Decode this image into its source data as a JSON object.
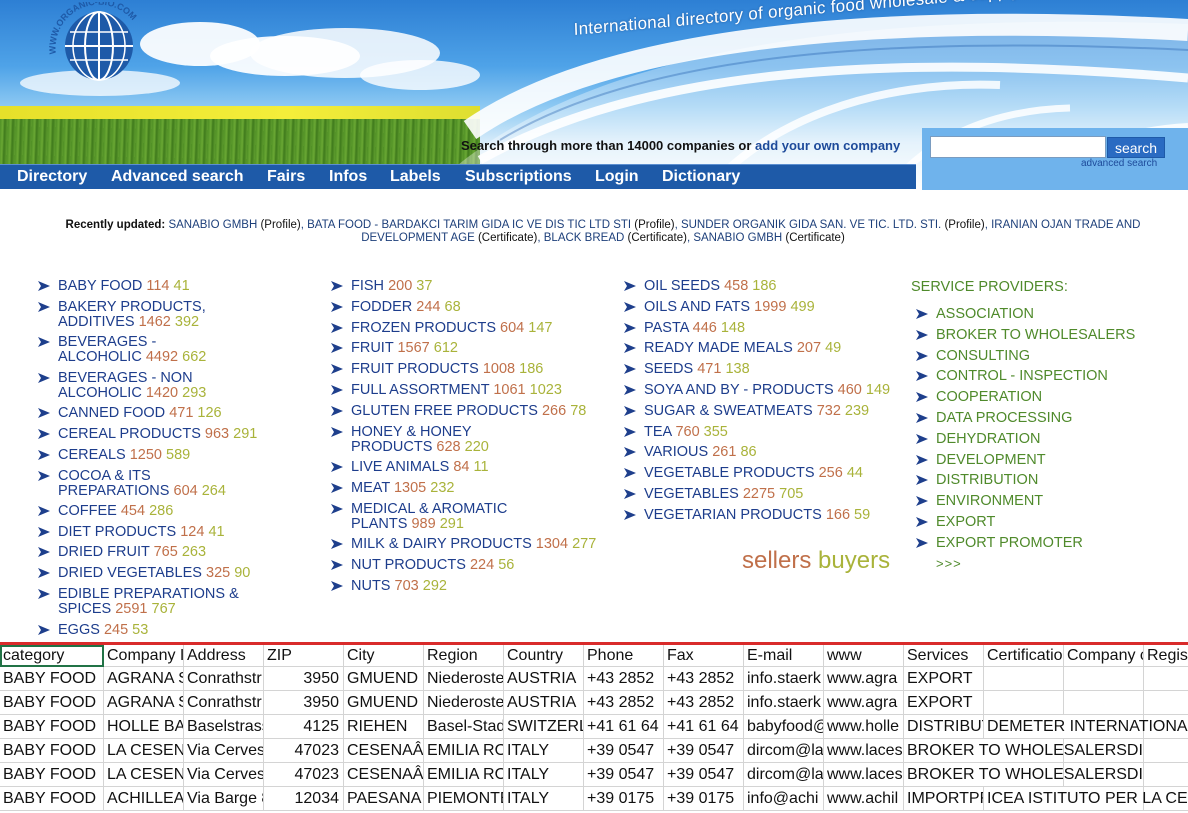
{
  "site": {
    "logo_text": "WWW.ORGANIC-BIO.COM",
    "tagline": "International directory of organic food wholesale & supply companies",
    "colors": {
      "nav_bg": "#1e5aa8",
      "link": "#1d3d8c",
      "count_sellers": "#c0704a",
      "count_buyers": "#a9b33a",
      "services": "#4f8a2b",
      "sheet_divider": "#d92b2b"
    }
  },
  "search": {
    "prompt": "Search through more than 14000 companies or ",
    "add_link": "add your own company",
    "input_value": "",
    "button_label": "search",
    "advanced_link": "advanced search"
  },
  "nav": [
    "Directory",
    "Advanced search",
    "Fairs",
    "Infos",
    "Labels",
    "Subscriptions",
    "Login",
    "Dictionary"
  ],
  "recent": {
    "label": "Recently updated:",
    "items": [
      {
        "name": "SANABIO GMBH",
        "type": "(Profile)"
      },
      {
        "name": "BATA FOOD - BARDAKCI TARIM GIDA IC VE DIS TIC LTD STI",
        "type": "(Profile)"
      },
      {
        "name": "SUNDER ORGANIK GIDA SAN. VE TIC. LTD. STI.",
        "type": "(Profile)"
      },
      {
        "name": "IRANIAN OJAN TRADE AND DEVELOPMENT AGE",
        "type": "(Certificate)"
      },
      {
        "name": "BLACK BREAD",
        "type": "(Certificate)"
      },
      {
        "name": "SANABIO GMBH",
        "type": "(Certificate)"
      }
    ]
  },
  "categories": {
    "col1": [
      {
        "l1": "BABY FOOD",
        "l2": "",
        "sellers": "114",
        "buyers": "41"
      },
      {
        "l1": "BAKERY PRODUCTS,",
        "l2": "ADDITIVES",
        "sellers": "1462",
        "buyers": "392"
      },
      {
        "l1": "BEVERAGES -",
        "l2": "ALCOHOLIC",
        "sellers": "4492",
        "buyers": "662"
      },
      {
        "l1": "BEVERAGES - NON",
        "l2": "ALCOHOLIC",
        "sellers": "1420",
        "buyers": "293"
      },
      {
        "l1": "CANNED FOOD",
        "l2": "",
        "sellers": "471",
        "buyers": "126"
      },
      {
        "l1": "CEREAL PRODUCTS",
        "l2": "",
        "sellers": "963",
        "buyers": "291"
      },
      {
        "l1": "CEREALS",
        "l2": "",
        "sellers": "1250",
        "buyers": "589"
      },
      {
        "l1": "COCOA & ITS",
        "l2": "PREPARATIONS",
        "sellers": "604",
        "buyers": "264"
      },
      {
        "l1": "COFFEE",
        "l2": "",
        "sellers": "454",
        "buyers": "286"
      },
      {
        "l1": "DIET PRODUCTS",
        "l2": "",
        "sellers": "124",
        "buyers": "41"
      },
      {
        "l1": "DRIED FRUIT",
        "l2": "",
        "sellers": "765",
        "buyers": "263"
      },
      {
        "l1": "DRIED VEGETABLES",
        "l2": "",
        "sellers": "325",
        "buyers": "90"
      },
      {
        "l1": "EDIBLE PREPARATIONS &",
        "l2": "SPICES",
        "sellers": "2591",
        "buyers": "767"
      },
      {
        "l1": "EGGS",
        "l2": "",
        "sellers": "245",
        "buyers": "53"
      }
    ],
    "col2": [
      {
        "l1": "FISH",
        "l2": "",
        "sellers": "200",
        "buyers": "37"
      },
      {
        "l1": "FODDER",
        "l2": "",
        "sellers": "244",
        "buyers": "68"
      },
      {
        "l1": "FROZEN PRODUCTS",
        "l2": "",
        "sellers": "604",
        "buyers": "147"
      },
      {
        "l1": "FRUIT",
        "l2": "",
        "sellers": "1567",
        "buyers": "612"
      },
      {
        "l1": "FRUIT PRODUCTS",
        "l2": "",
        "sellers": "1008",
        "buyers": "186"
      },
      {
        "l1": "FULL ASSORTMENT",
        "l2": "",
        "sellers": "1061",
        "buyers": "1023"
      },
      {
        "l1": "GLUTEN FREE PRODUCTS",
        "l2": "",
        "sellers": "266",
        "buyers": "78"
      },
      {
        "l1": "HONEY & HONEY",
        "l2": "PRODUCTS",
        "sellers": "628",
        "buyers": "220"
      },
      {
        "l1": "LIVE ANIMALS",
        "l2": "",
        "sellers": "84",
        "buyers": "11"
      },
      {
        "l1": "MEAT",
        "l2": "",
        "sellers": "1305",
        "buyers": "232"
      },
      {
        "l1": "MEDICAL & AROMATIC",
        "l2": "PLANTS",
        "sellers": "989",
        "buyers": "291"
      },
      {
        "l1": "MILK & DAIRY PRODUCTS",
        "l2": "",
        "sellers": "1304",
        "buyers": "277"
      },
      {
        "l1": "NUT PRODUCTS",
        "l2": "",
        "sellers": "224",
        "buyers": "56"
      },
      {
        "l1": "NUTS",
        "l2": "",
        "sellers": "703",
        "buyers": "292"
      }
    ],
    "col3": [
      {
        "l1": "OIL SEEDS",
        "l2": "",
        "sellers": "458",
        "buyers": "186"
      },
      {
        "l1": "OILS AND FATS",
        "l2": "",
        "sellers": "1999",
        "buyers": "499"
      },
      {
        "l1": "PASTA",
        "l2": "",
        "sellers": "446",
        "buyers": "148"
      },
      {
        "l1": "READY MADE MEALS",
        "l2": "",
        "sellers": "207",
        "buyers": "49"
      },
      {
        "l1": "SEEDS",
        "l2": "",
        "sellers": "471",
        "buyers": "138"
      },
      {
        "l1": "SOYA AND BY - PRODUCTS",
        "l2": "",
        "sellers": "460",
        "buyers": "149"
      },
      {
        "l1": "SUGAR & SWEATMEATS",
        "l2": "",
        "sellers": "732",
        "buyers": "239"
      },
      {
        "l1": "TEA",
        "l2": "",
        "sellers": "760",
        "buyers": "355"
      },
      {
        "l1": "VARIOUS",
        "l2": "",
        "sellers": "261",
        "buyers": "86"
      },
      {
        "l1": "VEGETABLE PRODUCTS",
        "l2": "",
        "sellers": "256",
        "buyers": "44"
      },
      {
        "l1": "VEGETABLES",
        "l2": "",
        "sellers": "2275",
        "buyers": "705"
      },
      {
        "l1": "VEGETARIAN PRODUCTS",
        "l2": "",
        "sellers": "166",
        "buyers": "59"
      }
    ]
  },
  "services": {
    "title": "SERVICE PROVIDERS:",
    "items": [
      "ASSOCIATION",
      "BROKER TO WHOLESALERS",
      "CONSULTING",
      "CONTROL - INSPECTION",
      "COOPERATION",
      "DATA PROCESSING",
      "DEHYDRATION",
      "DEVELOPMENT",
      "DISTRIBUTION",
      "ENVIRONMENT",
      "EXPORT",
      "EXPORT PROMOTER"
    ],
    "more": ">>>"
  },
  "legend": {
    "sellers": "sellers",
    "buyers": "buyers"
  },
  "sheet": {
    "headers": [
      "category",
      "Company I",
      "Address",
      "ZIP",
      "City",
      "Region",
      "Country",
      "Phone",
      "Fax",
      "E-mail",
      "www",
      "Services",
      "Certificatio",
      "Company c",
      "Regist"
    ],
    "rows": [
      [
        "BABY FOOD",
        "AGRANA S",
        "Conrathstr",
        "3950",
        "GMUEND",
        "Niederoste",
        "AUSTRIA",
        "+43  2852",
        "+43  2852",
        "info.staerk",
        "www.agra",
        "EXPORT",
        "",
        "",
        ""
      ],
      [
        "BABY FOOD",
        "AGRANA S",
        "Conrathstr",
        "3950",
        "GMUEND",
        "Niederoste",
        "AUSTRIA",
        "+43  2852",
        "+43  2852",
        "info.staerk",
        "www.agra",
        "EXPORT",
        "",
        "",
        ""
      ],
      [
        "BABY FOOD",
        "HOLLE BAE",
        "Baselstrass",
        "4125",
        "RIEHEN",
        "Basel-Stad",
        "SWITZERLA",
        "+41  61 64",
        "+41  61 64",
        "babyfood@",
        "www.holle",
        "DISTRIBUT",
        "DEMETER INTERNATIONAL",
        "",
        ""
      ],
      [
        "BABY FOOD",
        "LA CESENA",
        "Via Cerves",
        "47023",
        "CESENAÂ",
        "EMILIA RO",
        "ITALY",
        "+39  0547",
        "+39  0547",
        "dircom@la",
        "www.laces",
        "BROKER TO WHOLESALERSDISTRIBUTI",
        "",
        "",
        ""
      ],
      [
        "BABY FOOD",
        "LA CESENA",
        "Via Cerves",
        "47023",
        "CESENAÂ",
        "EMILIA RO",
        "ITALY",
        "+39  0547",
        "+39  0547",
        "dircom@la",
        "www.laces",
        "BROKER TO WHOLESALERSDISTRIBUTI",
        "",
        "",
        ""
      ],
      [
        "BABY FOOD",
        "ACHILLEA",
        "Via Barge 8",
        "12034",
        "PAESANA",
        "PIEMONTE",
        "ITALY",
        "+39  0175",
        "+39  0175",
        "info@achi",
        "www.achil",
        "IMPORTPR",
        "ICEA ISTITUTO PER LA CERT",
        "",
        ""
      ]
    ]
  }
}
